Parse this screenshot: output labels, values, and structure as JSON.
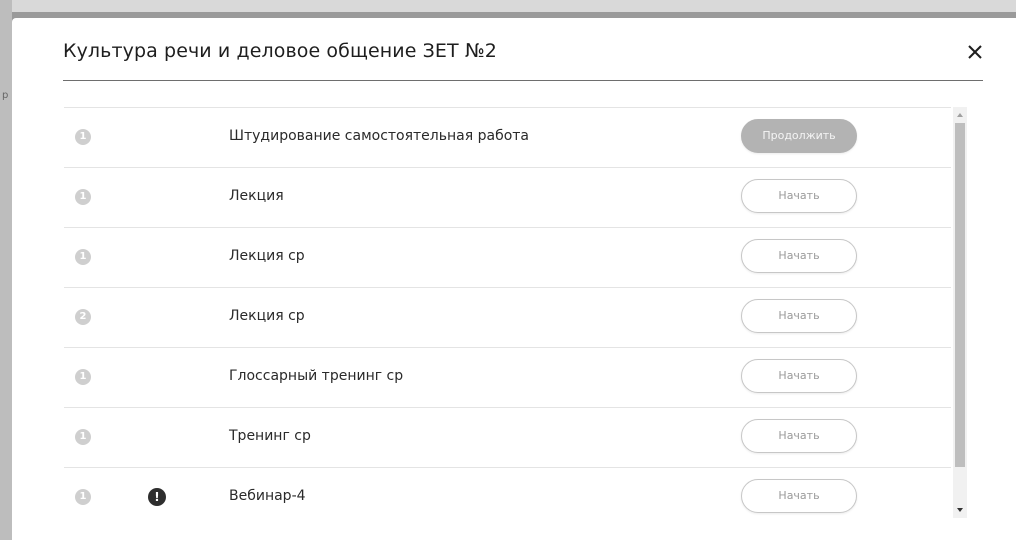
{
  "backdrop": {
    "mark": "р"
  },
  "modal": {
    "title": "Культура речи и деловое общение ЗЕТ №2",
    "close_icon": "close-icon"
  },
  "rows": [
    {
      "index": "1",
      "title": "Штудирование самостоятельная работа",
      "button": "Продолжить",
      "button_style": "primary",
      "warning": false
    },
    {
      "index": "1",
      "title": "Лекция",
      "button": "Начать",
      "button_style": "outline",
      "warning": false
    },
    {
      "index": "1",
      "title": "Лекция ср",
      "button": "Начать",
      "button_style": "outline",
      "warning": false
    },
    {
      "index": "2",
      "title": "Лекция ср",
      "button": "Начать",
      "button_style": "outline",
      "warning": false
    },
    {
      "index": "1",
      "title": "Глоссарный тренинг ср",
      "button": "Начать",
      "button_style": "outline",
      "warning": false
    },
    {
      "index": "1",
      "title": "Тренинг ср",
      "button": "Начать",
      "button_style": "outline",
      "warning": false
    },
    {
      "index": "1",
      "title": "Вебинар-4",
      "button": "Начать",
      "button_style": "outline",
      "warning": true,
      "warning_symbol": "!"
    }
  ],
  "colors": {
    "primary_button": "#b3b3b3",
    "outline_border": "#c7c7c7",
    "index_badge": "#cfcfcf",
    "warning_badge": "#2e2e2e"
  }
}
